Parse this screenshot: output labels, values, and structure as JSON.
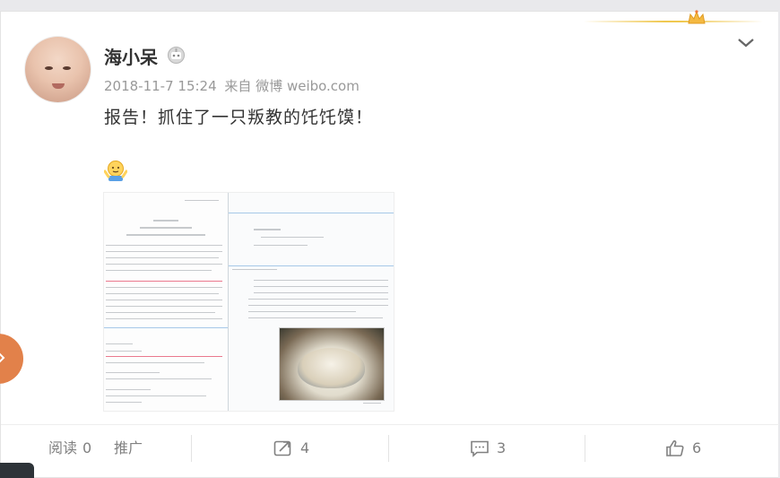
{
  "post": {
    "username": "海小呆",
    "timestamp": "2018-11-7 15:24",
    "source": "来自 微博 weibo.com",
    "text": "报告！抓住了一只叛教的饦饦馍！"
  },
  "icons": {
    "crown": "crown-icon",
    "vip": "vip-badge-icon",
    "menu": "chevron-down-icon",
    "emoji": "shrug-emoji-icon",
    "forward": "forward-icon",
    "comment": "comment-icon",
    "like": "like-icon"
  },
  "footer": {
    "read_label": "阅读",
    "read_count": "0",
    "promote_label": "推广",
    "forward_count": "4",
    "comment_count": "3",
    "like_count": "6"
  },
  "colors": {
    "accent": "#f0c850",
    "text": "#333333",
    "muted": "#808080",
    "orb": "#e2814a"
  }
}
